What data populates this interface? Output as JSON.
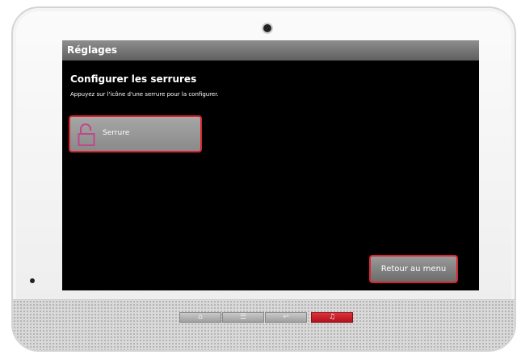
{
  "screen": {
    "title": "Réglages",
    "heading": "Configurer les serrures",
    "instruction": "Appuyez sur l'icône d'une serrure pour la configurer.",
    "lock_item": {
      "label": "Serrure",
      "icon": "unlocked-padlock-icon",
      "icon_color": "#c0488a"
    },
    "back_button_label": "Retour au menu",
    "accent_color": "#d8242e"
  },
  "hardware_keys": [
    {
      "name": "home-key",
      "icon": "home-icon",
      "glyph": "⌂"
    },
    {
      "name": "menu-key",
      "icon": "menu-icon",
      "glyph": "☰"
    },
    {
      "name": "back-key",
      "icon": "back-arrow-icon",
      "glyph": "↩"
    },
    {
      "name": "alarm-key",
      "icon": "bell-icon",
      "glyph": "♫"
    }
  ]
}
